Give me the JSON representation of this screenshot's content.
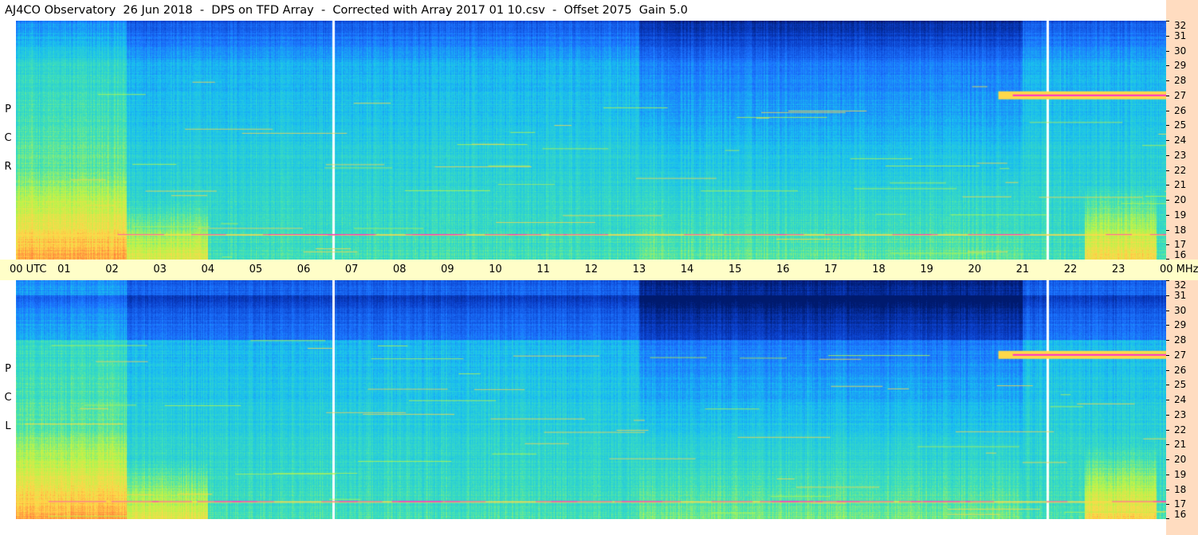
{
  "title": "AJ4CO Observatory  26 Jun 2018  -  DPS on TFD Array  -  Corrected with Array 2017 01 10.csv  -  Offset 2075  Gain 5.0",
  "polarizations": [
    {
      "id": "rcp",
      "letters": [
        "P",
        "C",
        "R"
      ]
    },
    {
      "id": "lcp",
      "letters": [
        "P",
        "C",
        "L"
      ]
    }
  ],
  "chart_data": {
    "type": "heatmap",
    "title": "AJ4CO Observatory  26 Jun 2018  -  DPS on TFD Array  -  Corrected with Array 2017 01 10.csv  -  Offset 2075  Gain 5.0",
    "xlabel": "UTC",
    "ylabel": "MHz",
    "x_tick_labels": [
      "00 UTC",
      "01",
      "02",
      "03",
      "04",
      "05",
      "06",
      "07",
      "08",
      "09",
      "10",
      "11",
      "12",
      "13",
      "14",
      "15",
      "16",
      "17",
      "18",
      "19",
      "20",
      "21",
      "22",
      "23",
      "00 MHz"
    ],
    "x_range_hours": [
      0,
      24
    ],
    "y_tick_labels": [
      "32",
      "31",
      "30",
      "29",
      "28",
      "27",
      "26",
      "25",
      "24",
      "23",
      "22",
      "21",
      "20",
      "19",
      "18",
      "17",
      "16"
    ],
    "y_range_mhz": [
      16,
      32
    ],
    "panels": [
      "RCP",
      "LCP"
    ],
    "colormap": [
      "#001a6e",
      "#0a3ec8",
      "#1c74ff",
      "#19bff0",
      "#3fe0b8",
      "#b9f54a",
      "#ffd84a",
      "#ff7a3a",
      "#ff2ad0"
    ],
    "data_gaps_utc_hours": [
      6.6,
      21.5
    ],
    "features": [
      {
        "panel": "RCP",
        "type": "strong emission band",
        "freq_mhz": 27,
        "utc_hours": [
          20.5,
          24
        ]
      },
      {
        "panel": "LCP",
        "type": "strong emission band",
        "freq_mhz": 27,
        "utc_hours": [
          20.5,
          24
        ]
      },
      {
        "panel": "RCP",
        "type": "broadband noise",
        "freq_mhz": [
          16,
          20
        ],
        "utc_hours": [
          0,
          4
        ]
      },
      {
        "panel": "RCP",
        "type": "broadband noise",
        "freq_mhz": [
          16,
          20
        ],
        "utc_hours": [
          22.3,
          23.7
        ]
      },
      {
        "panel": "RCP",
        "type": "interference line",
        "freq_mhz": 17.7,
        "utc_hours": [
          0,
          24
        ]
      },
      {
        "panel": "LCP",
        "type": "interference line",
        "freq_mhz": 17.2,
        "utc_hours": [
          0,
          24
        ]
      }
    ]
  },
  "colors": {
    "time_axis_bg": "#fffec8",
    "freq_axis_bg": "#ffdcc0",
    "gap_line": "#ffffff"
  }
}
